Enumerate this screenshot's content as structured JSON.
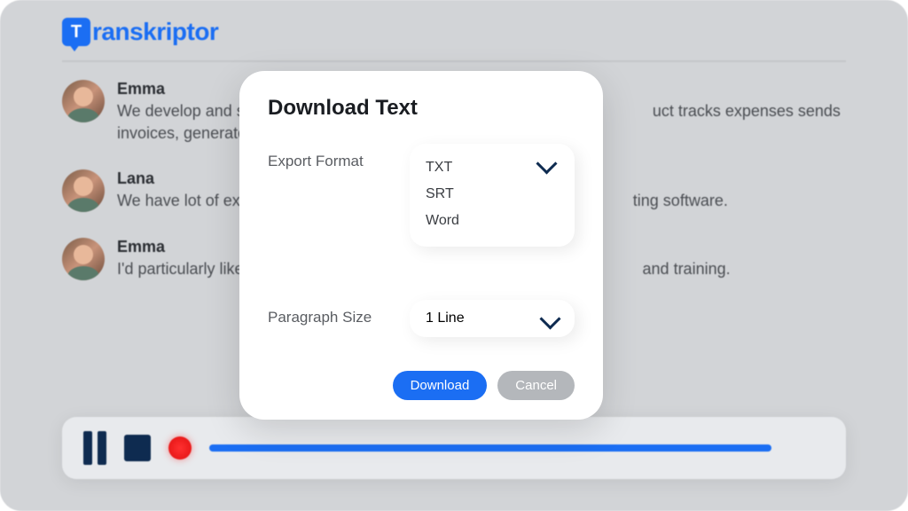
{
  "app": {
    "name": "Transkriptor",
    "logo_letter": "T",
    "logo_rest": "ranskriptor"
  },
  "colors": {
    "accent": "#1b6ef3",
    "dark": "#0e2b50",
    "record": "#ff3030"
  },
  "transcript": [
    {
      "speaker": "Emma",
      "text_before": "We develop and se",
      "text_after": "uct tracks expenses sends",
      "text_line2": "invoices, generates"
    },
    {
      "speaker": "Lana",
      "text_before": "We have lot of exis",
      "text_after": "ting software."
    },
    {
      "speaker": "Emma",
      "text_before": "I'd particularly like",
      "text_after": "and training."
    }
  ],
  "modal": {
    "title": "Download Text",
    "export_format_label": "Export Format",
    "export_options": [
      "TXT",
      "SRT",
      "Word"
    ],
    "paragraph_size_label": "Paragraph Size",
    "paragraph_size_value": "1 Line",
    "download_label": "Download",
    "cancel_label": "Cancel"
  }
}
